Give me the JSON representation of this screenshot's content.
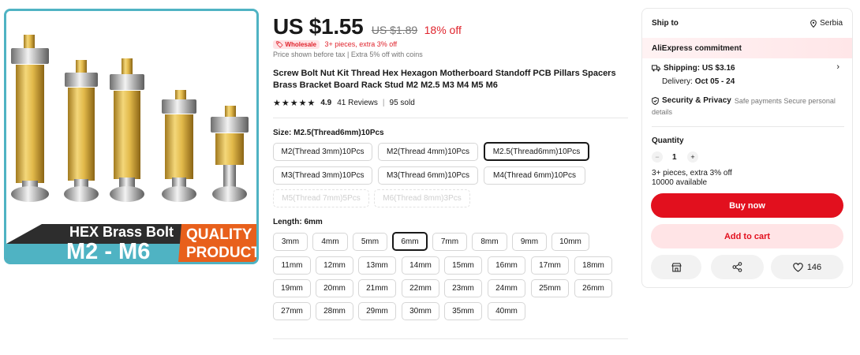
{
  "image": {
    "banner_line1": "HEX Brass Bolt",
    "banner_line2": "M2 - M6",
    "quality_line1": "QUALITY",
    "quality_line2": "PRODUCT"
  },
  "price": {
    "current": "US $1.55",
    "original": "US $1.89",
    "discount": "18% off"
  },
  "wholesale": {
    "badge": "Wholesale",
    "text": "3+ pieces, extra 3% off"
  },
  "tax_note": "Price shown before tax | Extra 5% off with coins",
  "product_title": "Screw Bolt Nut Kit Thread Hex Hexagon Motherboard Standoff PCB Pillars Spacers Brass Bracket Board Rack Stud M2 M2.5 M3 M4 M5 M6",
  "rating": {
    "stars": "★★★★★",
    "value": "4.9",
    "reviews": "41 Reviews",
    "separator": "|",
    "sold": "95 sold"
  },
  "size": {
    "label": "Size:",
    "selected": "M2.5(Thread6mm)10Pcs",
    "options": [
      "M2(Thread 3mm)10Pcs",
      "M2(Thread 4mm)10Pcs",
      "M2.5(Thread6mm)10Pcs",
      "M3(Thread 3mm)10Pcs",
      "M3(Thread 6mm)10Pcs",
      "M4(Thread 6mm)10Pcs",
      "M5(Thread 7mm)5Pcs",
      "M6(Thread 8mm)3Pcs"
    ]
  },
  "length": {
    "label": "Length:",
    "selected": "6mm",
    "options": [
      "3mm",
      "4mm",
      "5mm",
      "6mm",
      "7mm",
      "8mm",
      "9mm",
      "10mm",
      "11mm",
      "12mm",
      "13mm",
      "14mm",
      "15mm",
      "16mm",
      "17mm",
      "18mm",
      "19mm",
      "20mm",
      "21mm",
      "22mm",
      "23mm",
      "24mm",
      "25mm",
      "26mm",
      "27mm",
      "28mm",
      "29mm",
      "30mm",
      "35mm",
      "40mm"
    ]
  },
  "panel": {
    "ship_to": "Ship to",
    "country": "Serbia",
    "commitment": "AliExpress commitment",
    "shipping": "Shipping: US $3.16",
    "delivery_label": "Delivery:",
    "delivery_dates": "Oct 05 - 24",
    "security": "Security & Privacy",
    "security_sub": "Safe payments Secure personal",
    "security_more": "details",
    "quantity_label": "Quantity",
    "quantity": "1",
    "minus": "−",
    "plus": "+",
    "qty_note": "3+ pieces, extra 3% off",
    "available": "10000 available",
    "buy_now": "Buy now",
    "add_to_cart": "Add to cart",
    "wish_count": "146"
  }
}
